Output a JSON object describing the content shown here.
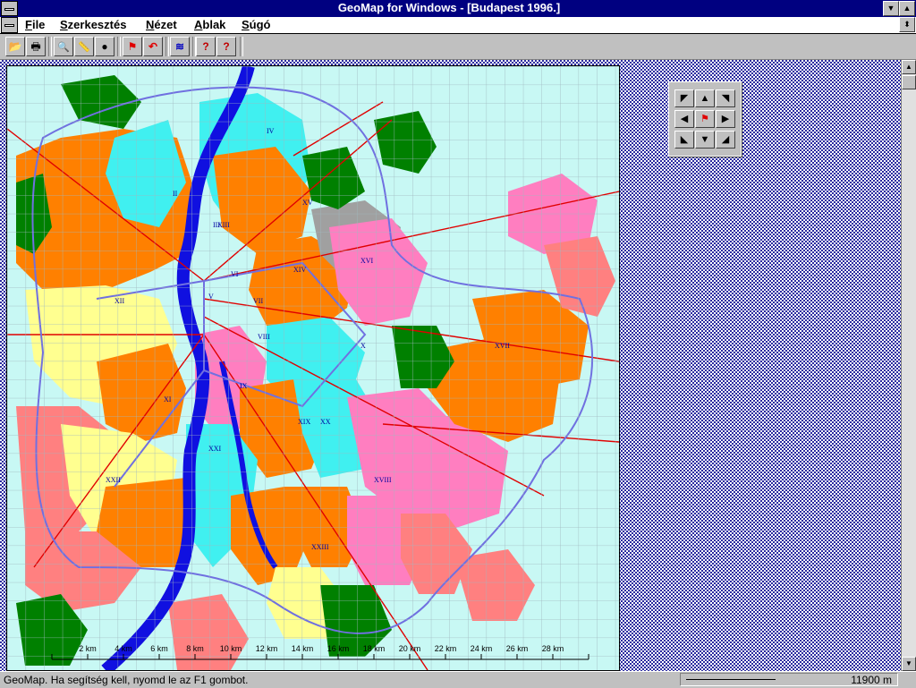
{
  "window": {
    "title": "GeoMap for Windows - [Budapest 1996.]"
  },
  "menu": [
    {
      "label": "File"
    },
    {
      "label": "Szerkesztés"
    },
    {
      "label": "Nézet"
    },
    {
      "label": "Ablak"
    },
    {
      "label": "Súgó"
    }
  ],
  "toolbar": {
    "buttons": [
      {
        "name": "open-icon",
        "glyph": "📂"
      },
      {
        "name": "print-icon",
        "glyph": "🖶"
      },
      {
        "name": "zoom-icon",
        "glyph": "🔍"
      },
      {
        "name": "ruler-icon",
        "glyph": "📏"
      },
      {
        "name": "globe-icon",
        "glyph": "●"
      },
      {
        "name": "flag-icon",
        "glyph": "⚑"
      },
      {
        "name": "undo-flag-icon",
        "glyph": "↶"
      },
      {
        "name": "layers-icon",
        "glyph": "≋"
      },
      {
        "name": "help-icon",
        "glyph": "?"
      },
      {
        "name": "context-help-icon",
        "glyph": "?"
      }
    ]
  },
  "map": {
    "scale_labels": [
      "2 km",
      "4 km",
      "6 km",
      "8 km",
      "10 km",
      "12 km",
      "14 km",
      "16 km",
      "18 km",
      "20 km",
      "22 km",
      "24 km",
      "26 km",
      "28 km"
    ],
    "district_labels": [
      "I",
      "II",
      "III",
      "IV",
      "V",
      "VI",
      "VII",
      "VIII",
      "IX",
      "X",
      "XI",
      "XII",
      "XIII",
      "XIV",
      "XV",
      "XVI",
      "XVII",
      "XVIII",
      "XIX",
      "XX",
      "XXI",
      "XXII",
      "XXIII"
    ],
    "colors": {
      "background": "#c8f8f4",
      "river": "#1010e0",
      "orange": "#ff8000",
      "pink": "#ff7ec0",
      "green": "#008000",
      "yellow": "#ffff90",
      "cyan": "#40f0f0",
      "salmon": "#ff8080",
      "road": "#e00000"
    }
  },
  "navigator": {
    "center_glyph": "⚑"
  },
  "status": {
    "message": "GeoMap. Ha segítség kell, nyomd le az F1 gombot.",
    "scale": "11900 m"
  }
}
